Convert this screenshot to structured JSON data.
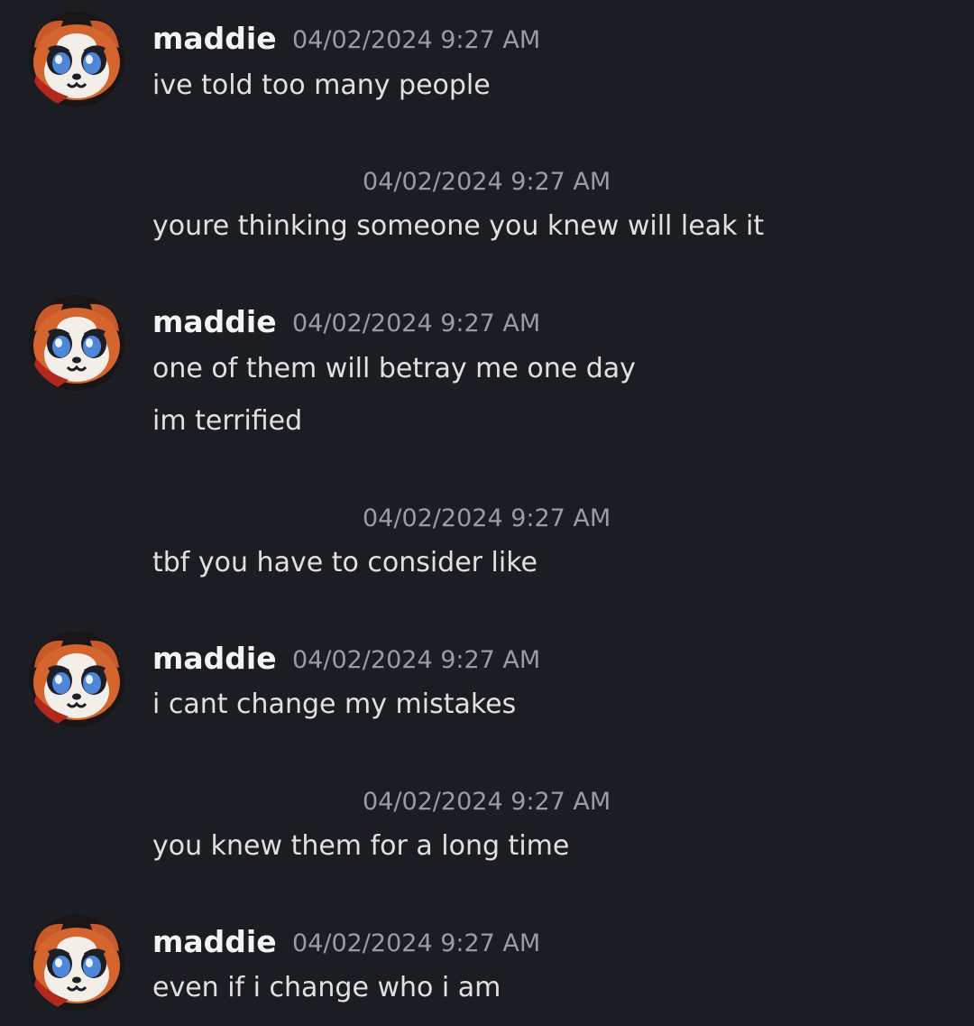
{
  "messages": [
    {
      "type": "group",
      "author": "maddie",
      "timestamp": "04/02/2024 9:27 AM",
      "lines": [
        "ive told too many people"
      ]
    },
    {
      "type": "continuation",
      "timestamp": "04/02/2024 9:27 AM",
      "lines": [
        "youre thinking someone you knew will leak it"
      ]
    },
    {
      "type": "group",
      "author": "maddie",
      "timestamp": "04/02/2024 9:27 AM",
      "lines": [
        "one of them will betray me one day",
        "im terrified"
      ]
    },
    {
      "type": "continuation",
      "timestamp": "04/02/2024 9:27 AM",
      "lines": [
        "tbf you have to consider like"
      ]
    },
    {
      "type": "group",
      "author": "maddie",
      "timestamp": "04/02/2024 9:27 AM",
      "lines": [
        "i cant change my mistakes"
      ]
    },
    {
      "type": "continuation",
      "timestamp": "04/02/2024 9:27 AM",
      "lines": [
        "you knew them for a long time"
      ]
    },
    {
      "type": "group",
      "author": "maddie",
      "timestamp": "04/02/2024 9:27 AM",
      "lines": [
        "even if i change who i am"
      ]
    }
  ],
  "avatar_icon": "red-panda-avatar-icon",
  "colors": {
    "background": "#1c1d22",
    "username": "#f2f3f5",
    "timestamp": "#9a9ca4",
    "message_text": "#dfe0e4"
  }
}
